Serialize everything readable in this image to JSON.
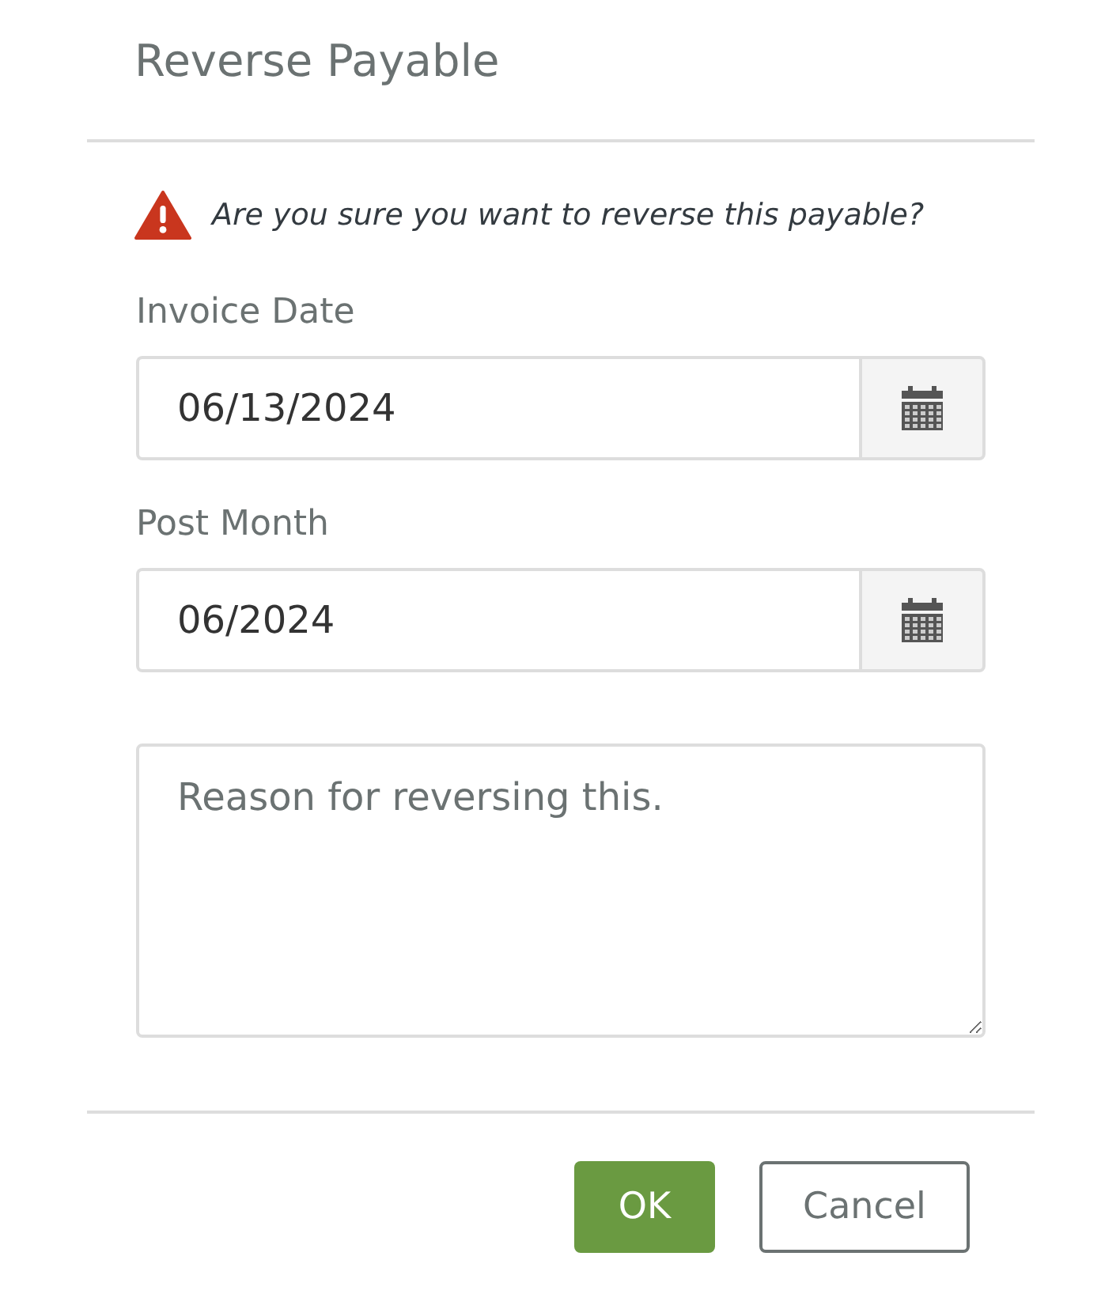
{
  "dialog": {
    "title": "Reverse Payable"
  },
  "warning": {
    "message": "Are you sure you want to reverse this payable?"
  },
  "fields": [
    {
      "label": "Invoice Date",
      "value": "06/13/2024",
      "kind": "date"
    },
    {
      "label": "Post Month",
      "value": "06/2024",
      "kind": "date"
    }
  ],
  "reason": {
    "placeholder": "Reason for reversing this."
  },
  "buttons": [
    {
      "label": "OK",
      "kind": "primary"
    },
    {
      "label": "Cancel",
      "kind": "secondary"
    }
  ]
}
